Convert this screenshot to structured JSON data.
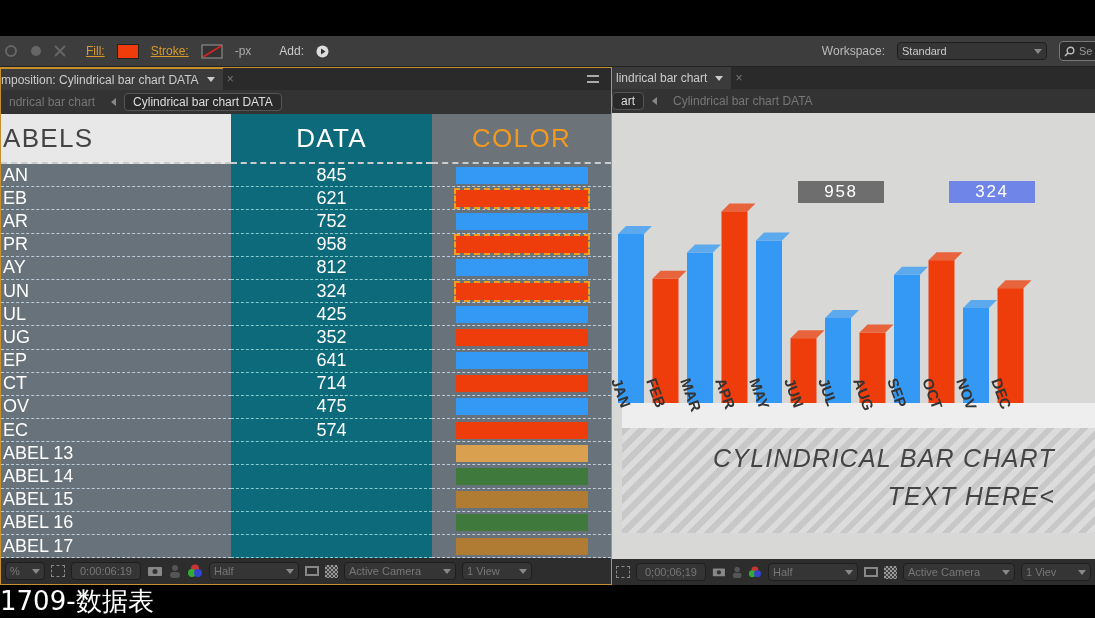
{
  "toolbar": {
    "fill_label": "Fill:",
    "stroke_label": "Stroke:",
    "px": "-px",
    "add_label": "Add:",
    "workspace_label": "Workspace:",
    "workspace": "Standard",
    "search_placeholder": "Se"
  },
  "left_panel": {
    "tab": "mposition: Cylindrical bar chart DATA",
    "tab_close": "×",
    "breadcrumbs": [
      {
        "label": "ndrical bar chart",
        "selected": false
      },
      {
        "label": "Cylindrical bar chart DATA",
        "selected": true
      }
    ],
    "table": {
      "columns": [
        "ABELS",
        "DATA",
        "COLOR"
      ],
      "rows": [
        {
          "label": "AN",
          "value": "845",
          "color": "#3399f5",
          "selected": false
        },
        {
          "label": "EB",
          "value": "621",
          "color": "#ee3d0a",
          "selected": true
        },
        {
          "label": "AR",
          "value": "752",
          "color": "#3399f5",
          "selected": false
        },
        {
          "label": "PR",
          "value": "958",
          "color": "#ee3d0a",
          "selected": true
        },
        {
          "label": "AY",
          "value": "812",
          "color": "#3399f5",
          "selected": false
        },
        {
          "label": "UN",
          "value": "324",
          "color": "#ee3d0a",
          "selected": true
        },
        {
          "label": "UL",
          "value": "425",
          "color": "#3399f5",
          "selected": false
        },
        {
          "label": "UG",
          "value": "352",
          "color": "#ee3d0a",
          "selected": false
        },
        {
          "label": "EP",
          "value": "641",
          "color": "#3399f5",
          "selected": false
        },
        {
          "label": "CT",
          "value": "714",
          "color": "#ee3d0a",
          "selected": false
        },
        {
          "label": "OV",
          "value": "475",
          "color": "#3399f5",
          "selected": false
        },
        {
          "label": "EC",
          "value": "574",
          "color": "#ee3d0a",
          "selected": false
        },
        {
          "label": "ABEL 13",
          "color": "#d9a050",
          "selected": false
        },
        {
          "label": "ABEL 14",
          "color": "#3f7a3c",
          "selected": false
        },
        {
          "label": "ABEL 15",
          "color": "#b07c34",
          "selected": false
        },
        {
          "label": "ABEL 16",
          "color": "#3f7a3c",
          "selected": false
        },
        {
          "label": "ABEL 17",
          "color": "#b07c34",
          "selected": false
        }
      ]
    },
    "footer": {
      "zoom": "%",
      "timecode": "0:00:06:19",
      "resolution": "Half",
      "camera": "Active Camera",
      "views": "1 View"
    }
  },
  "right_panel": {
    "tab": "lindrical bar chart",
    "tab_close": "×",
    "breadcrumbs": [
      {
        "label": "art",
        "selected": true
      },
      {
        "label": "Cylindrical bar chart DATA",
        "selected": false
      }
    ],
    "chart": {
      "months": [
        "JAN",
        "FEB",
        "MAR",
        "APR",
        "MAY",
        "JUN",
        "JUL",
        "AUG",
        "SEP",
        "OCT",
        "NOV",
        "DEC"
      ],
      "callouts": [
        {
          "value": "958",
          "color": "#6e6e6e"
        },
        {
          "value": "324",
          "color": "#6f86e8"
        }
      ],
      "title": "CYLINDRICAL BAR CHART",
      "subtitle": "TEXT HERE<"
    },
    "footer": {
      "timecode": "0;00;06;19",
      "resolution": "Half",
      "camera": "Active Camera",
      "views": "1 Viev"
    }
  },
  "caption": "1709-数据表"
}
